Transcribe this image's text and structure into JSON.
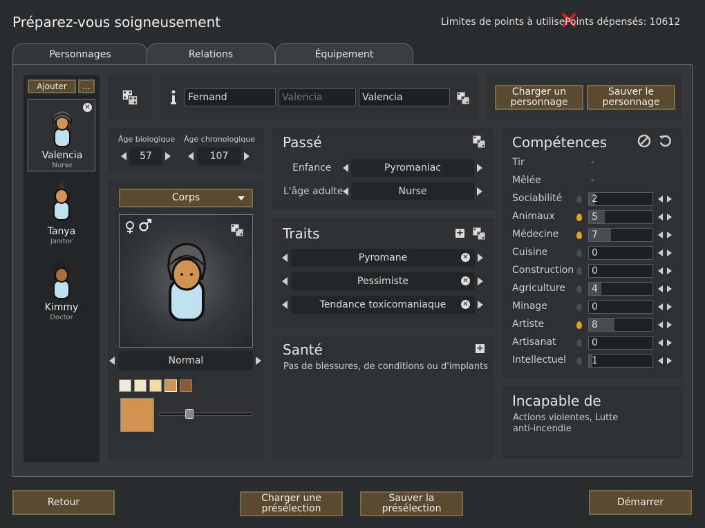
{
  "header": {
    "title": "Préparez-vous soigneusement",
    "points_limit_label": "Limites de points à utiliser",
    "points_spent_label": "Points dépensés: 10612"
  },
  "tabs": [
    "Personnages",
    "Relations",
    "Équipement"
  ],
  "pawn_list": {
    "add_label": "Ajouter",
    "more_label": "...",
    "pawns": [
      {
        "name": "Valencia",
        "job": "Nurse"
      },
      {
        "name": "Tanya",
        "job": "Janitor"
      },
      {
        "name": "Kimmy",
        "job": "Doctor"
      }
    ]
  },
  "name": {
    "first": "Fernand",
    "nick_placeholder": "Valencia",
    "last": "Valencia"
  },
  "file_buttons": {
    "load": "Charger un personnage",
    "save": "Sauver le personnage"
  },
  "age": {
    "bio_label": "Âge biologique",
    "bio_value": "57",
    "chrono_label": "Âge chronologique",
    "chrono_value": "107"
  },
  "appearance": {
    "dropdown": "Corps",
    "body_type": "Normal",
    "swatches": [
      "#f2e9dd",
      "#f5e6c6",
      "#f3dda0",
      "#d19350",
      "#8c5a2e"
    ],
    "selected_skin": "#d19350",
    "slider_value": 0.3
  },
  "backstory": {
    "title": "Passé",
    "childhood_label": "Enfance",
    "childhood_value": "Pyromaniac",
    "adulthood_label": "L'âge adulte",
    "adulthood_value": "Nurse"
  },
  "traits": {
    "title": "Traits",
    "items": [
      "Pyromane",
      "Pessimiste",
      "Tendance toxicomaniaque"
    ]
  },
  "health": {
    "title": "Santé",
    "text": "Pas de blessures, de conditions ou d'implants"
  },
  "skills": {
    "title": "Compétences",
    "items": [
      {
        "name": "Tir",
        "value": "-",
        "passion": "none"
      },
      {
        "name": "Mêlée",
        "value": "-",
        "passion": "none"
      },
      {
        "name": "Sociabilité",
        "value": "2",
        "passion": "none"
      },
      {
        "name": "Animaux",
        "value": "5",
        "passion": "minor"
      },
      {
        "name": "Médecine",
        "value": "7",
        "passion": "minor"
      },
      {
        "name": "Cuisine",
        "value": "0",
        "passion": "none"
      },
      {
        "name": "Construction",
        "value": "0",
        "passion": "none"
      },
      {
        "name": "Agriculture",
        "value": "4",
        "passion": "none"
      },
      {
        "name": "Minage",
        "value": "0",
        "passion": "none"
      },
      {
        "name": "Artiste",
        "value": "8",
        "passion": "minor"
      },
      {
        "name": "Artisanat",
        "value": "0",
        "passion": "none"
      },
      {
        "name": "Intellectuel",
        "value": "1",
        "passion": "none"
      }
    ]
  },
  "incapable": {
    "title": "Incapable de",
    "text": "Actions violentes, Lutte anti-incendie"
  },
  "footer": {
    "back": "Retour",
    "load_preset": "Charger une présélection",
    "save_preset": "Sauver la présélection",
    "start": "Démarrer"
  }
}
